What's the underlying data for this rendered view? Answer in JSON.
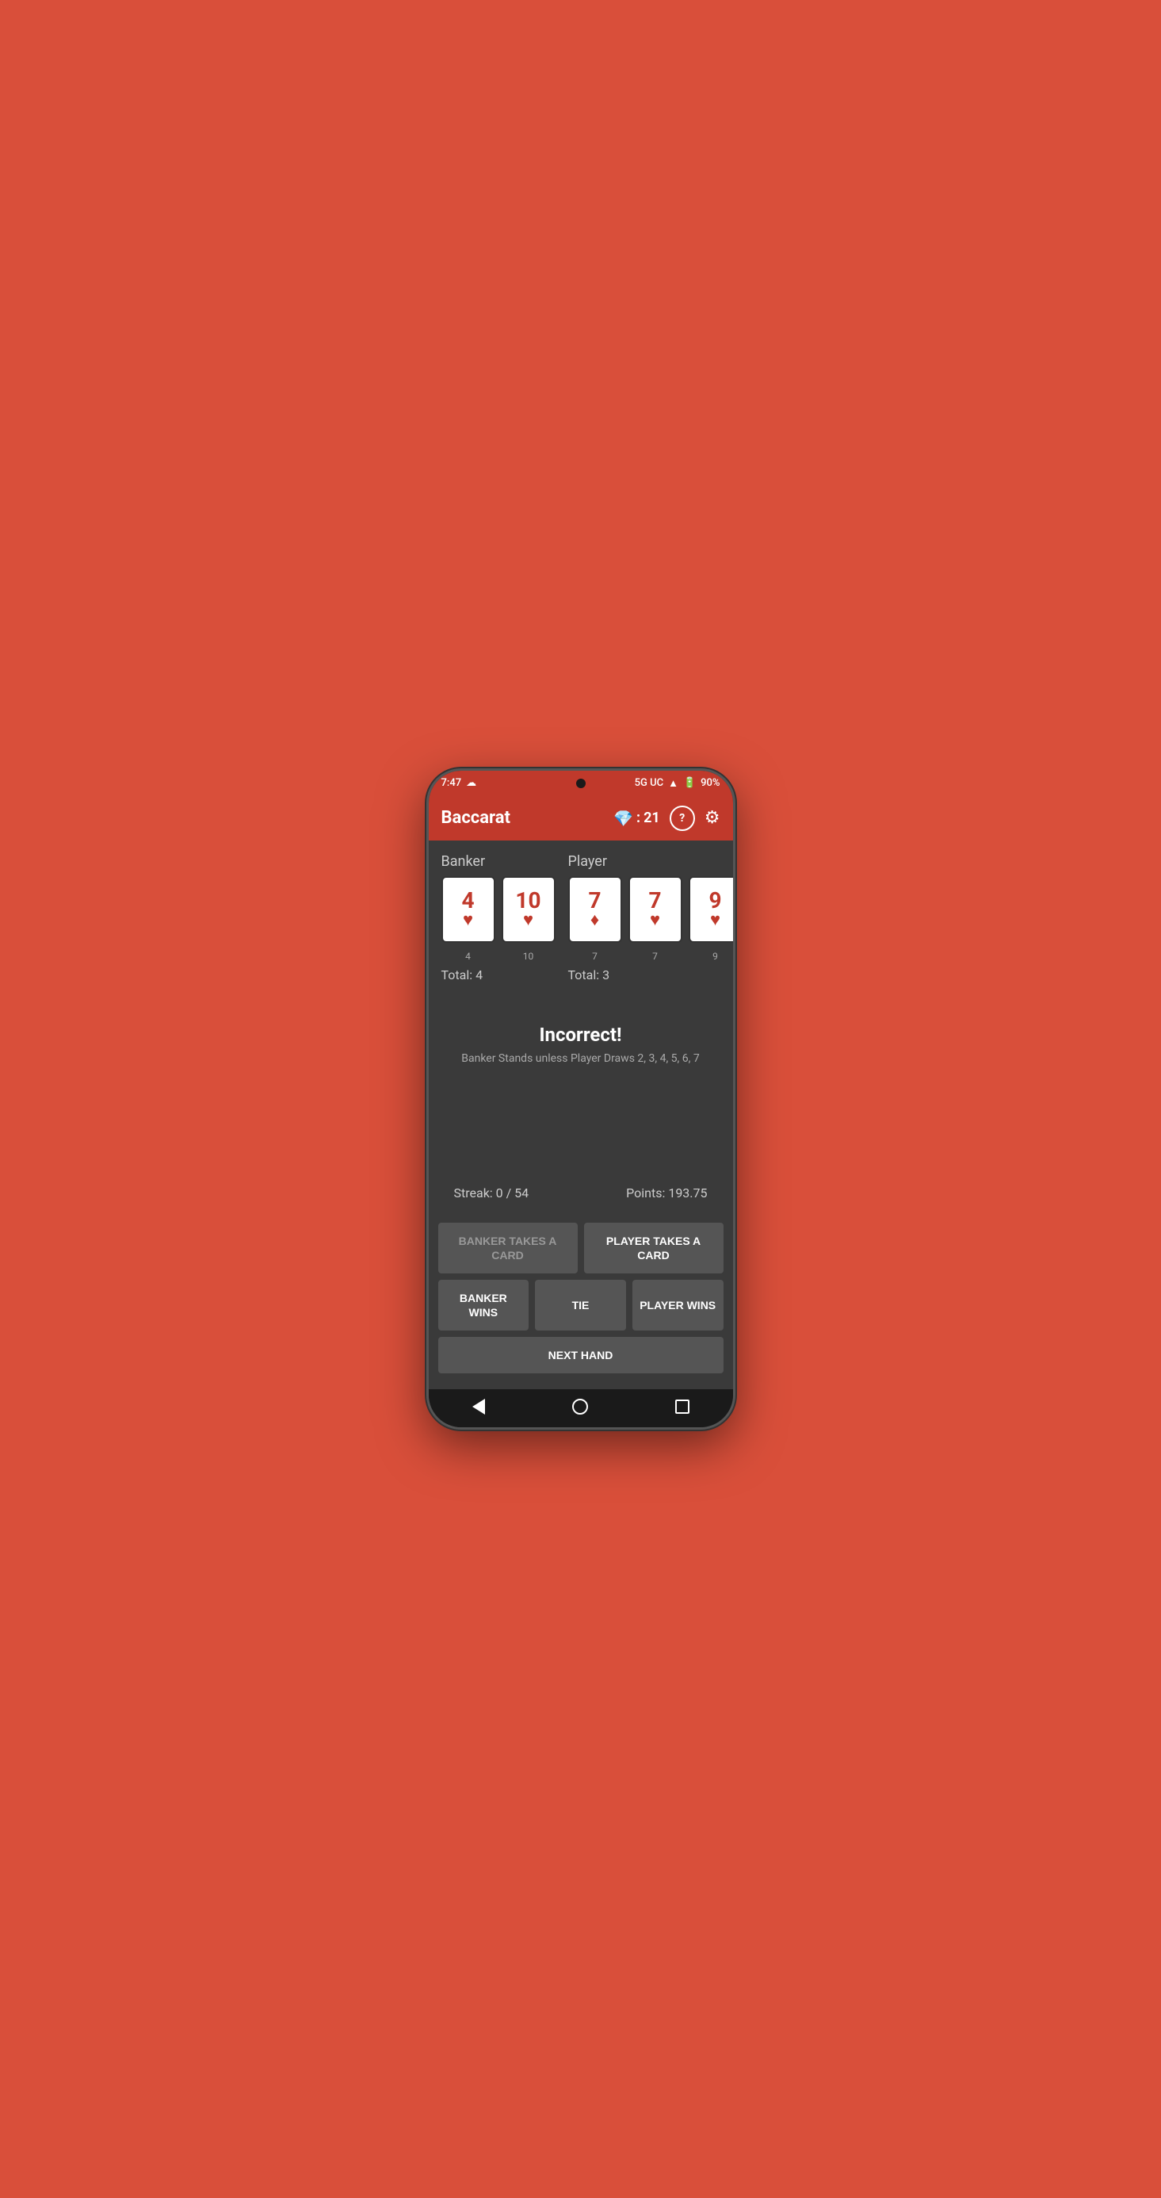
{
  "status": {
    "time": "7:47",
    "network": "5G UC",
    "battery": "90%"
  },
  "appBar": {
    "title": "Baccarat",
    "gemScore": "21",
    "helpLabel": "?",
    "settingsLabel": "⚙"
  },
  "banker": {
    "label": "Banker",
    "cards": [
      {
        "value": "4",
        "suit": "♥",
        "number": "4"
      },
      {
        "value": "10",
        "suit": "♥",
        "number": "10"
      }
    ],
    "total": "Total: 4"
  },
  "player": {
    "label": "Player",
    "cards": [
      {
        "value": "7",
        "suit": "♦",
        "number": "7"
      },
      {
        "value": "7",
        "suit": "♥",
        "number": "7"
      },
      {
        "value": "9",
        "suit": "♥",
        "number": "9"
      }
    ],
    "total": "Total: 3"
  },
  "feedback": {
    "title": "Incorrect!",
    "subtitle": "Banker Stands unless Player Draws 2, 3, 4, 5, 6, 7"
  },
  "stats": {
    "streak": "Streak: 0 / 54",
    "points": "Points: 193.75"
  },
  "buttons": {
    "bankerTakesCard": "BANKER TAKES A CARD",
    "playerTakesCard": "PLAYER TAKES A CARD",
    "bankerWins": "BANKER WINS",
    "tie": "TIE",
    "playerWins": "PLAYER WINS",
    "nextHand": "NEXT HAND"
  }
}
